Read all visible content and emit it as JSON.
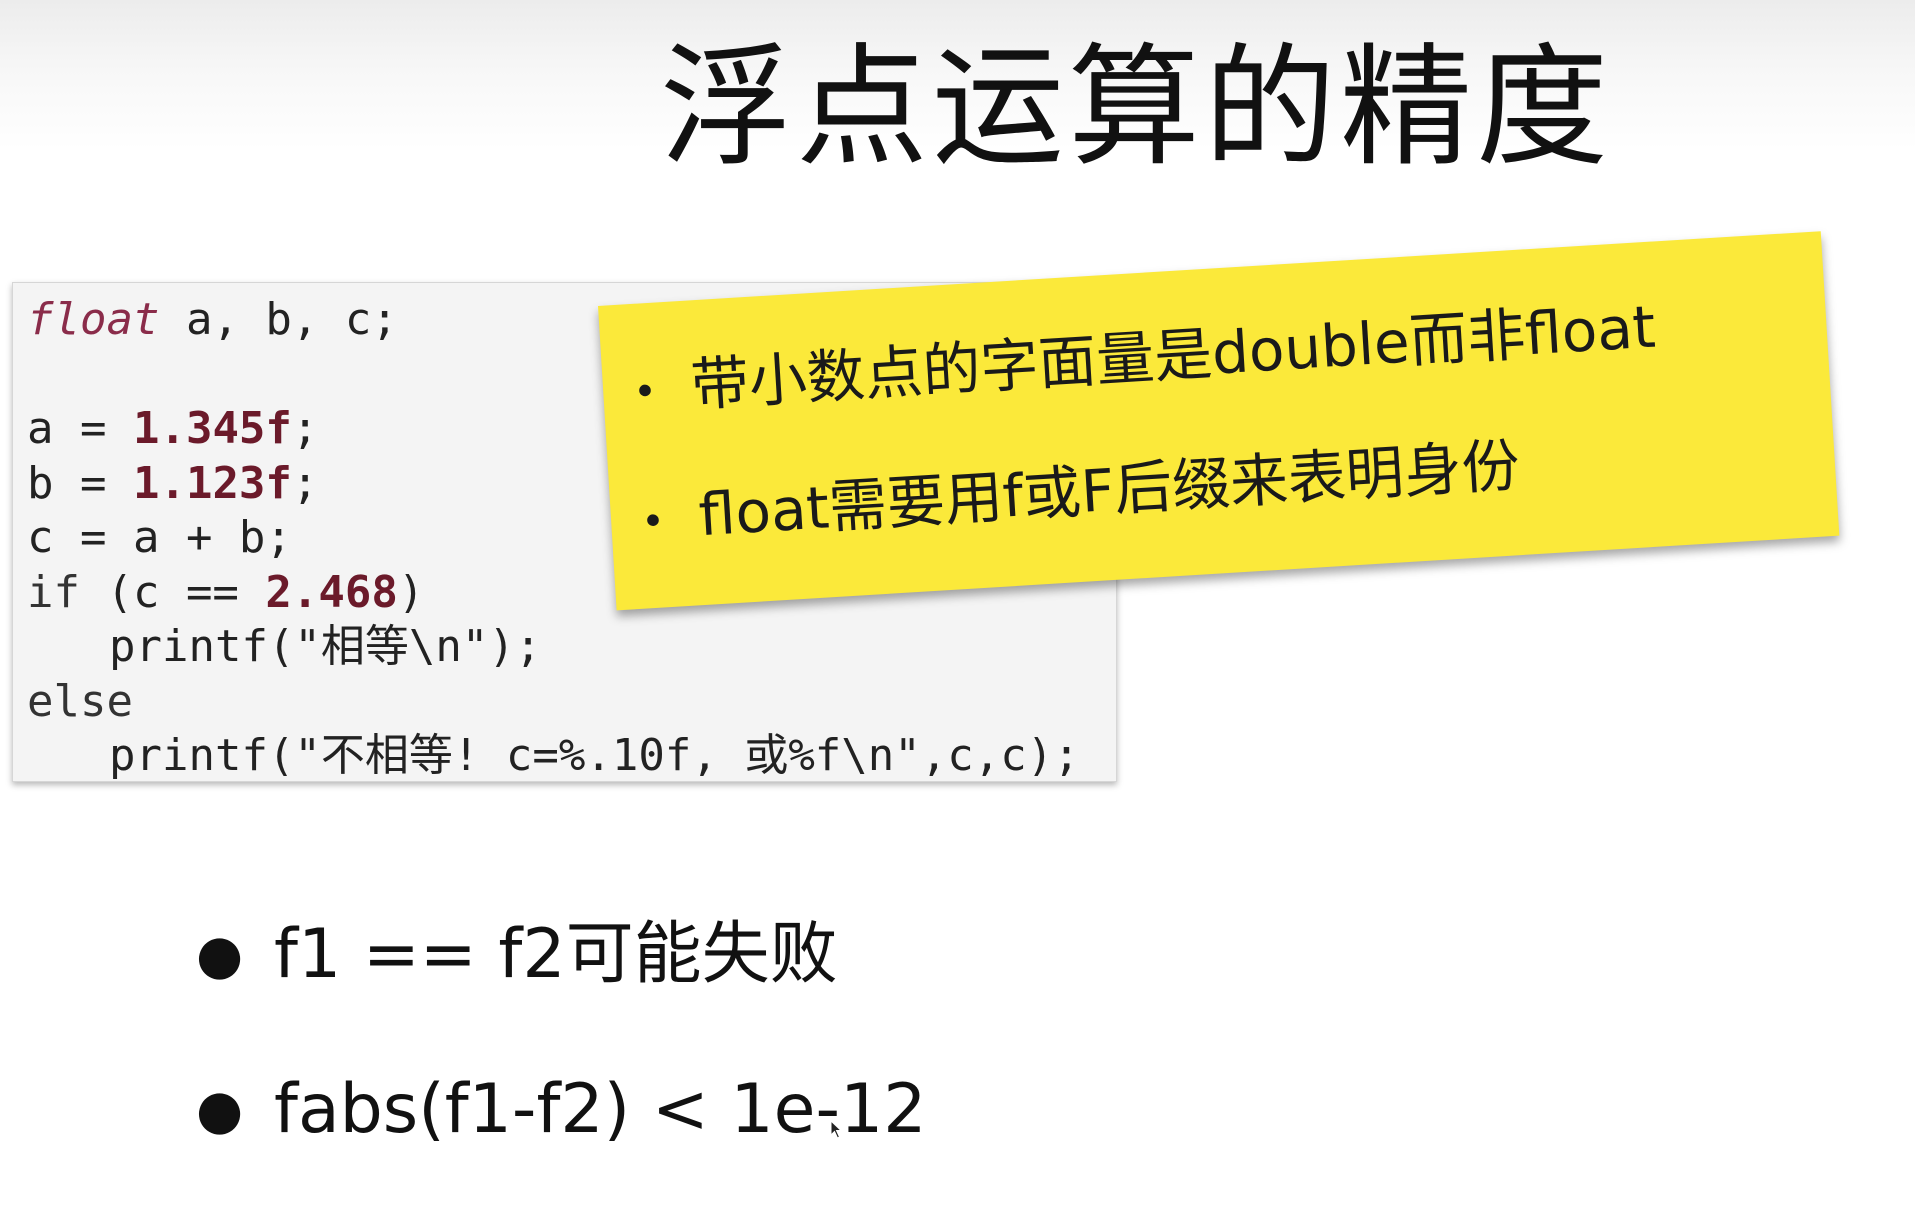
{
  "slide": {
    "title": "浮点运算的精度"
  },
  "code": {
    "line1_kw": "float",
    "line1_rest": " a, b, c;",
    "line3_prefix": "a = ",
    "line3_num": "1.345f",
    "line3_suffix": ";",
    "line4_prefix": "b = ",
    "line4_num": "1.123f",
    "line4_suffix": ";",
    "line5": "c = a + b;",
    "line6_kw": "if",
    "line6_prefix": " (c == ",
    "line6_num": "2.468",
    "line6_suffix": ")",
    "line7": "printf(\"相等\\n\");",
    "line8_kw": "else",
    "line9": "printf(\"不相等! c=%.10f, 或%f\\n\",c,c);"
  },
  "sticky_note": {
    "bullet": "•",
    "items": [
      "带小数点的字面量是double而非float",
      "float需要用f或F后缀来表明身份"
    ]
  },
  "bullets": {
    "dot": "●",
    "items": [
      "f1 == f2可能失败",
      "fabs(f1-f2) < 1e-12"
    ]
  }
}
